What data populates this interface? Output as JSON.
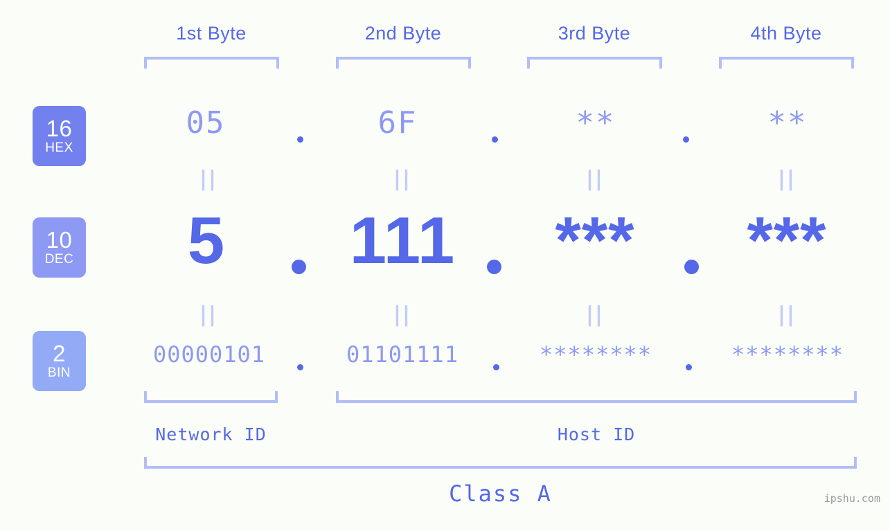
{
  "meta": {
    "background_color": "#fbfdf8",
    "accent_strong": "#5468e8",
    "accent_mid": "#8d99f2",
    "accent_light": "#b3bdf7",
    "badge_hex_color": "#7381ee",
    "badge_dec_color": "#8d99f2",
    "badge_bin_color": "#93aaf7"
  },
  "headers": [
    {
      "label": "1st Byte"
    },
    {
      "label": "2nd Byte"
    },
    {
      "label": "3rd Byte"
    },
    {
      "label": "4th Byte"
    }
  ],
  "badges": [
    {
      "number": "16",
      "name": "HEX"
    },
    {
      "number": "10",
      "name": "DEC"
    },
    {
      "number": "2",
      "name": "BIN"
    }
  ],
  "rows": {
    "hex": {
      "radix": "16",
      "name": "HEX",
      "octets": [
        "05",
        "6F",
        "**",
        "**"
      ]
    },
    "dec": {
      "radix": "10",
      "name": "DEC",
      "octets": [
        "5",
        "111",
        "***",
        "***"
      ]
    },
    "bin": {
      "radix": "2",
      "name": "BIN",
      "octets": [
        "00000101",
        "01101111",
        "********",
        "********"
      ]
    }
  },
  "separators": {
    "dot": "."
  },
  "equals_glyph": "||",
  "segments": {
    "network_id": "Network ID",
    "host_id": "Host ID",
    "class": "Class A"
  },
  "watermark": "ipshu.com"
}
